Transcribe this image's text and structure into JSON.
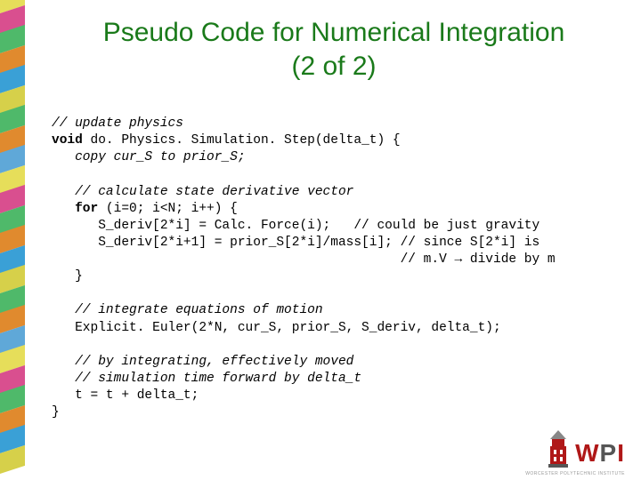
{
  "title": "Pseudo Code for Numerical Integration\n(2 of 2)",
  "code": {
    "c1": "// update physics",
    "l1a": "void",
    "l1b": " do. Physics. Simulation. Step(delta_t) {",
    "l2": "   copy cur_S to prior_S;",
    "c2": "   // calculate state derivative vector",
    "l3a": "   for",
    "l3b": " (i=0; i<N; i++) {",
    "l4": "      S_deriv[2*i] = Calc. Force(i);   // could be just gravity",
    "l5": "      S_deriv[2*i+1] = prior_S[2*i]/mass[i]; // since S[2*i] is",
    "l6a": "                                             // m.V ",
    "l6arrow": "→",
    "l6b": " divide by m",
    "l7": "   }",
    "c3": "   // integrate equations of motion",
    "l8": "   Explicit. Euler(2*N, cur_S, prior_S, S_deriv, delta_t);",
    "c4": "   // by integrating, effectively moved",
    "c5": "   // simulation time forward by delta_t",
    "l9": "   t = t + delta_t;",
    "l10": "}"
  },
  "logo": {
    "w": "W",
    "p": "P",
    "i": "I",
    "sub": "WORCESTER POLYTECHNIC INSTITUTE"
  },
  "stripe_colors": [
    "#e6de5a",
    "#d94f8f",
    "#4fb96a",
    "#e08a2e",
    "#3aa0d6",
    "#d6d04a",
    "#4fb96a",
    "#e08a2e",
    "#5fa8d8",
    "#e6de5a",
    "#d94f8f",
    "#4fb96a",
    "#e08a2e",
    "#3aa0d6",
    "#d6d04a",
    "#4fb96a",
    "#e08a2e",
    "#5fa8d8",
    "#e6de5a",
    "#d94f8f",
    "#4fb96a",
    "#e08a2e",
    "#3aa0d6",
    "#d6d04a"
  ]
}
